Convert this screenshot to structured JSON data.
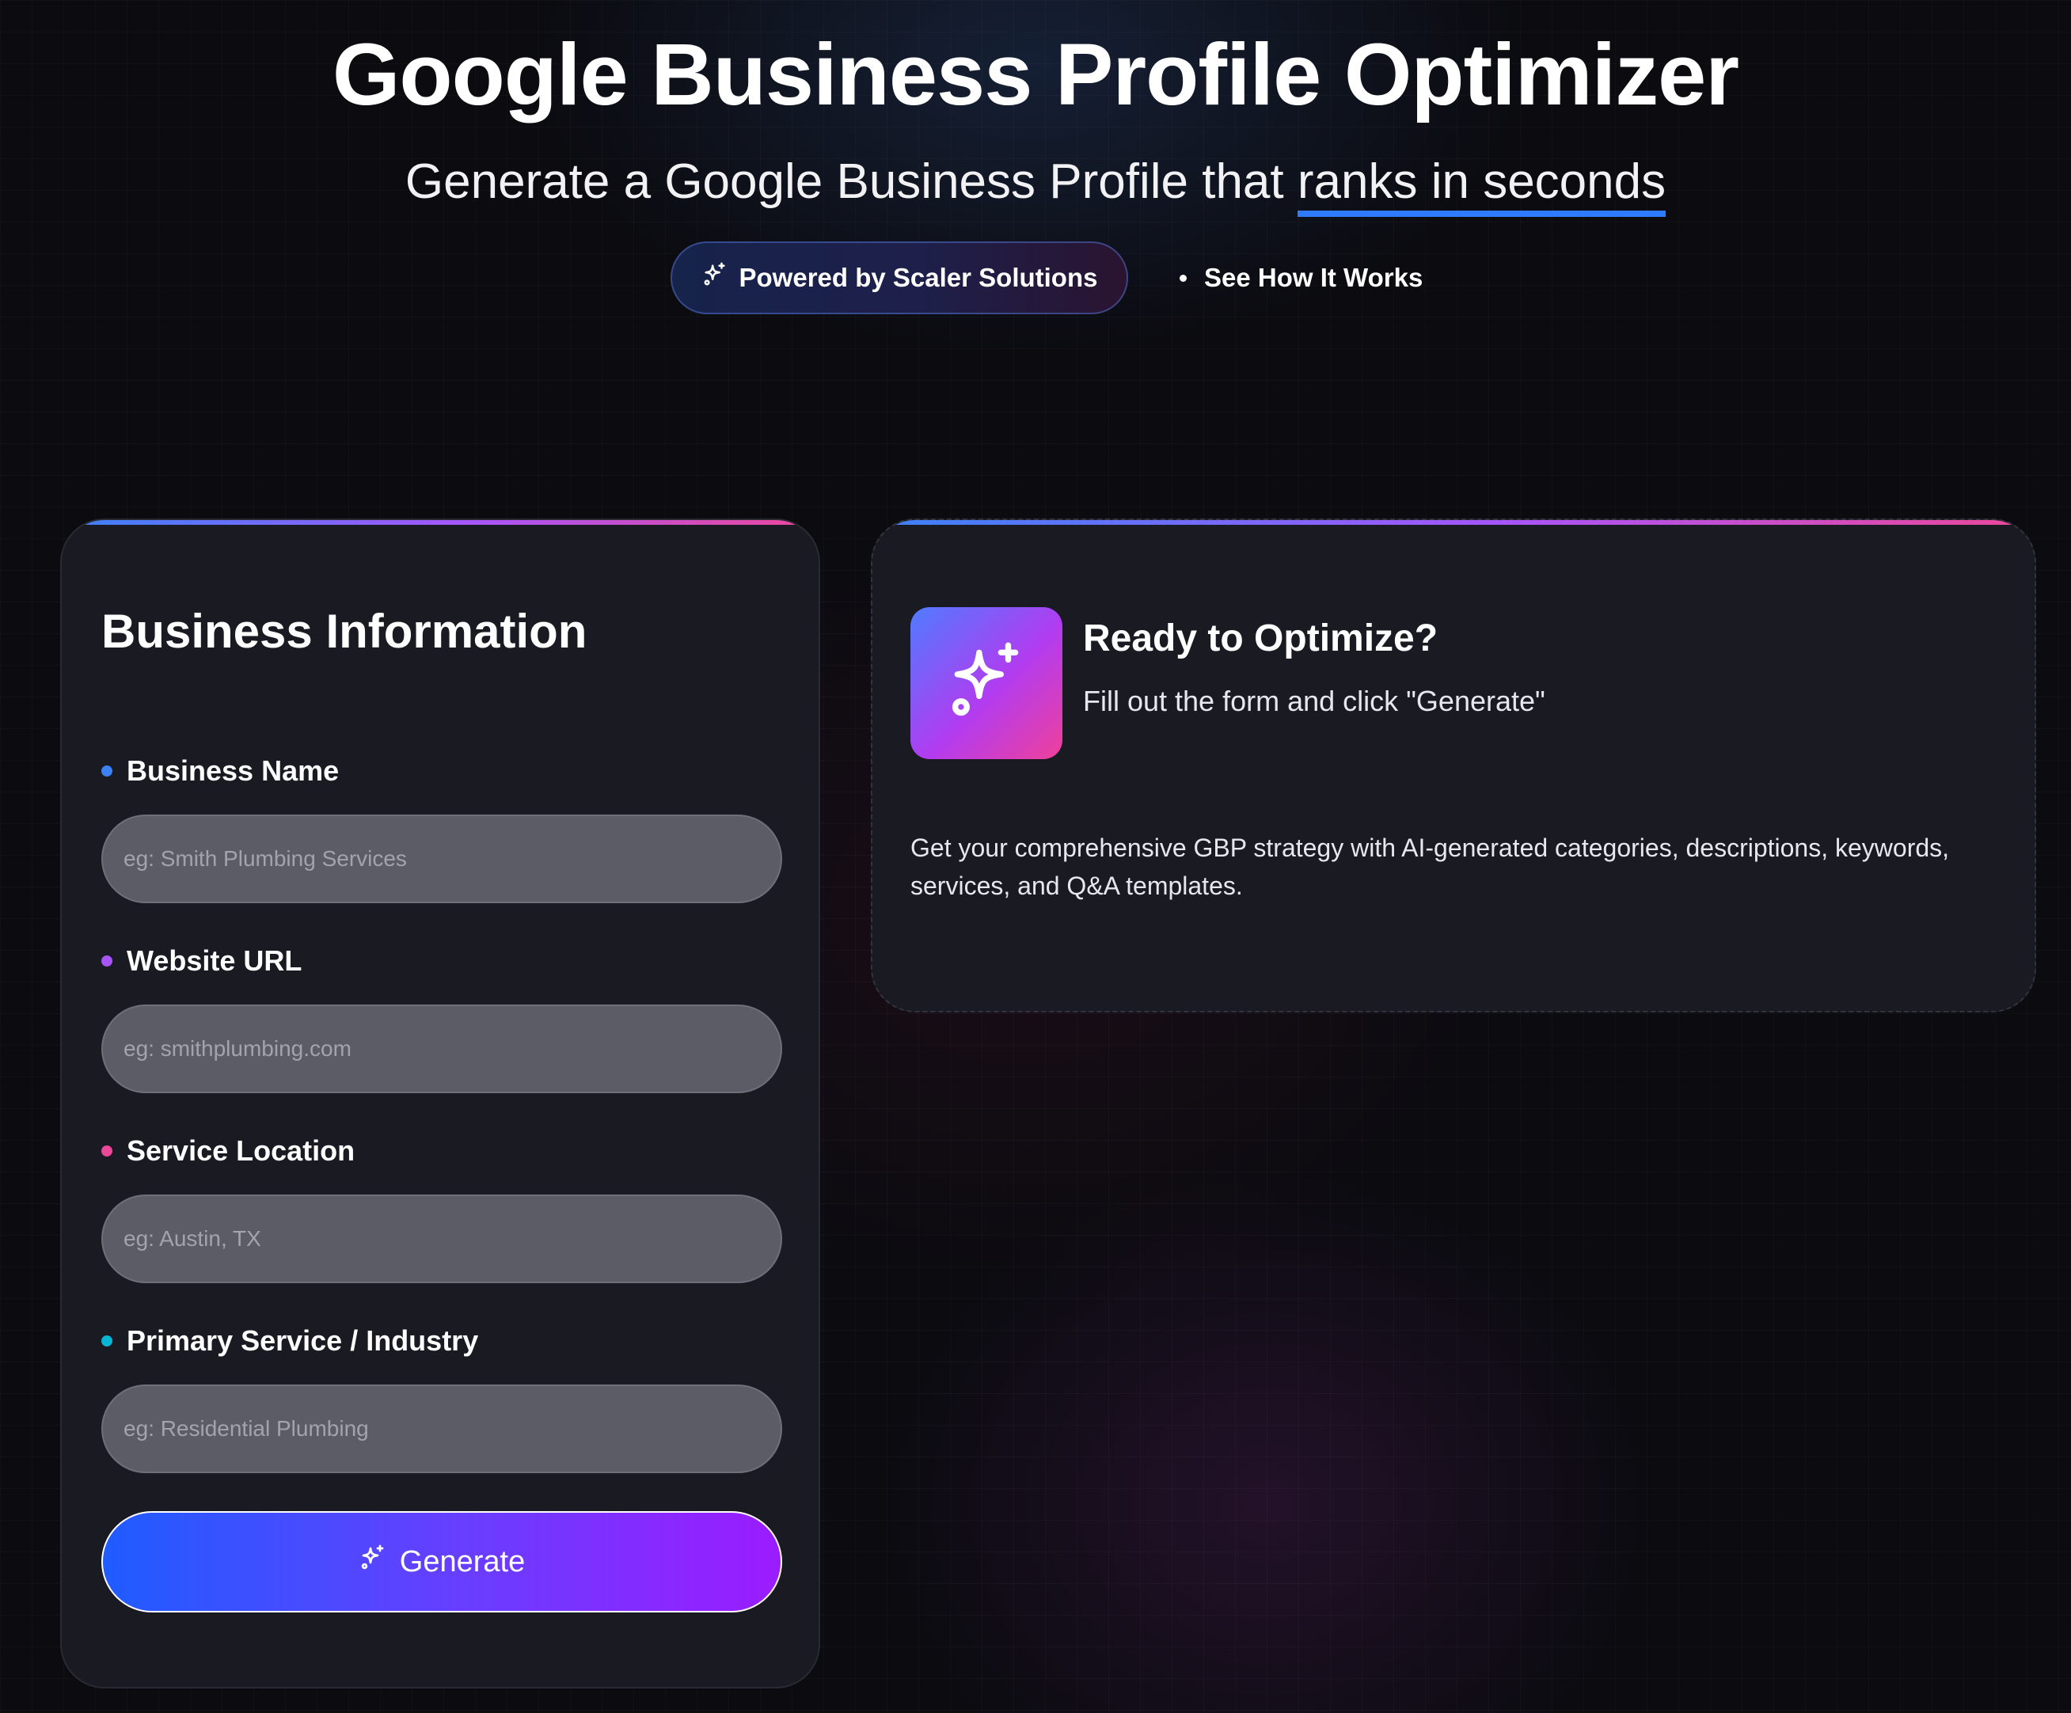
{
  "header": {
    "title": "Google Business Profile Optimizer",
    "subtitle_prefix": "Generate a Google Business Profile that ",
    "subtitle_highlight": "ranks in seconds",
    "badge_label": "Powered by Scaler Solutions",
    "how_link_label": "See How It Works"
  },
  "form": {
    "title": "Business Information",
    "fields": [
      {
        "label": "Business Name",
        "placeholder": "eg: Smith Plumbing Services",
        "value": "",
        "bullet_color": "#3b82f6"
      },
      {
        "label": "Website URL",
        "placeholder": "eg: smithplumbing.com",
        "value": "",
        "bullet_color": "#a855f7"
      },
      {
        "label": "Service Location",
        "placeholder": "eg: Austin, TX",
        "value": "",
        "bullet_color": "#ec4899"
      },
      {
        "label": "Primary Service / Industry",
        "placeholder": "eg: Residential Plumbing",
        "value": "",
        "bullet_color": "#06b6d4"
      }
    ],
    "generate_label": "Generate"
  },
  "result": {
    "title": "Ready to Optimize?",
    "subtitle": "Fill out the form and click \"Generate\"",
    "description": "Get your comprehensive GBP strategy with AI-generated categories, descriptions, keywords, services, and Q&A templates."
  },
  "icons": {
    "badge_icon": "sparkles-icon",
    "generate_icon": "sparkles-icon",
    "tile_icon": "sparkles-icon"
  },
  "colors": {
    "background": "#0b0b10",
    "card": "#1a1a22",
    "accent_blue": "#2f7bff",
    "accent_purple": "#a855f7",
    "accent_pink": "#ec4899"
  }
}
